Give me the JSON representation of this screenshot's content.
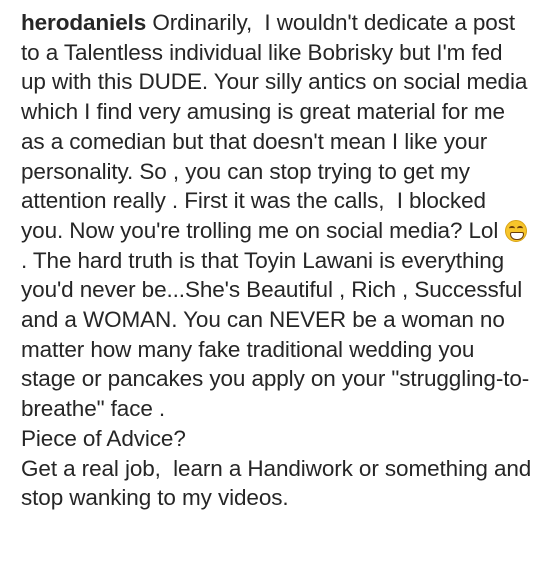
{
  "post": {
    "username": "herodaniels",
    "caption_before_emoji": " Ordinarily,  I wouldn't dedicate a post to a Talentless individual like Bobrisky but I'm fed up with this DUDE. Your silly antics on social media which I find very amusing is great material for me as a comedian but that doesn't mean I like your personality. So , you can stop trying to get my attention really . First it was the calls,  I blocked you. Now you're trolling me on social media? Lol ",
    "emoji_icon": "grinning-squinting-face-emoji",
    "caption_after_emoji": ". The hard truth is that Toyin Lawani is everything you'd never be...She's Beautiful , Rich , Successful and a WOMAN. You can NEVER be a woman no matter how many fake traditional wedding you stage or pancakes you apply on your \"struggling-to-breathe\" face .\nPiece of Advice?\nGet a real job,  learn a Handiwork or something and stop wanking to my videos."
  }
}
